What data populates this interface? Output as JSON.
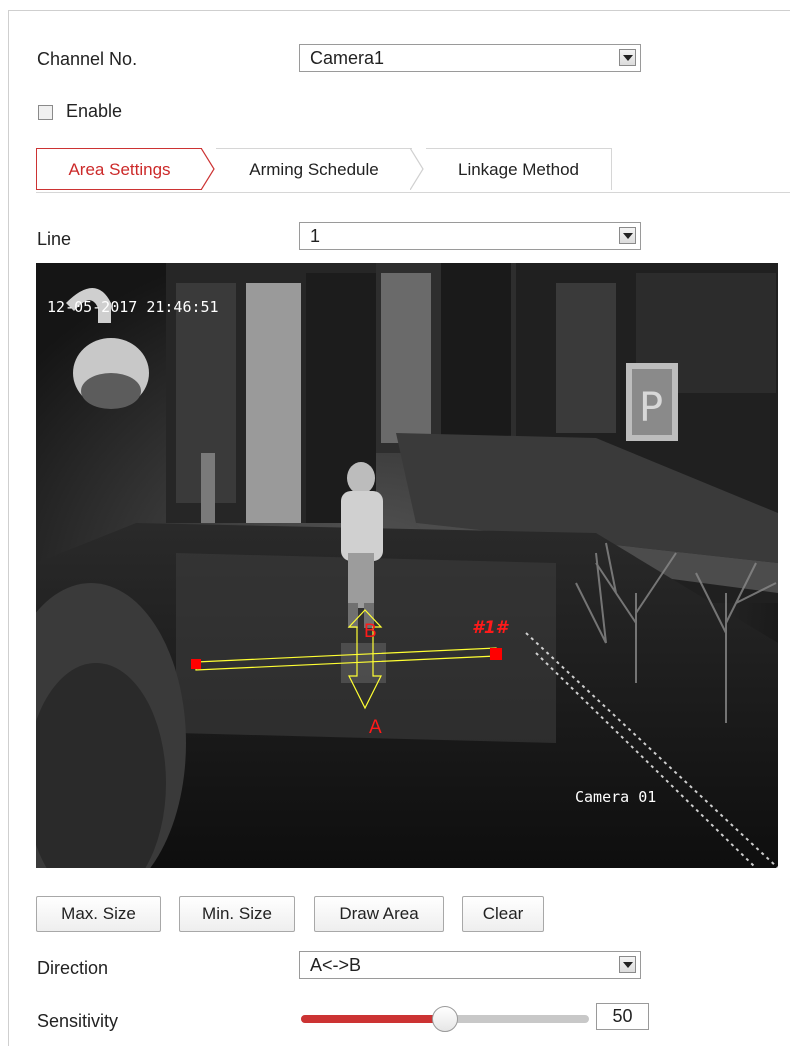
{
  "channel": {
    "label": "Channel No.",
    "value": "Camera1"
  },
  "enable": {
    "label": "Enable",
    "checked": false
  },
  "tabs": [
    {
      "label": "Area Settings",
      "active": true
    },
    {
      "label": "Arming Schedule",
      "active": false
    },
    {
      "label": "Linkage Method",
      "active": false
    }
  ],
  "line": {
    "label": "Line",
    "value": "1"
  },
  "video": {
    "timestamp": "12-05-2017 21:46:51",
    "camera_name": "Camera 01",
    "line_id": "#1#",
    "side_a": "A",
    "side_b": "B"
  },
  "buttons": {
    "max_size": "Max. Size",
    "min_size": "Min. Size",
    "draw_area": "Draw Area",
    "clear": "Clear"
  },
  "direction": {
    "label": "Direction",
    "value": "A<->B"
  },
  "sensitivity": {
    "label": "Sensitivity",
    "value": "50",
    "level": 50
  },
  "colors": {
    "accent": "#cc3333",
    "line": "#ffff33",
    "marker": "#ff0000"
  }
}
